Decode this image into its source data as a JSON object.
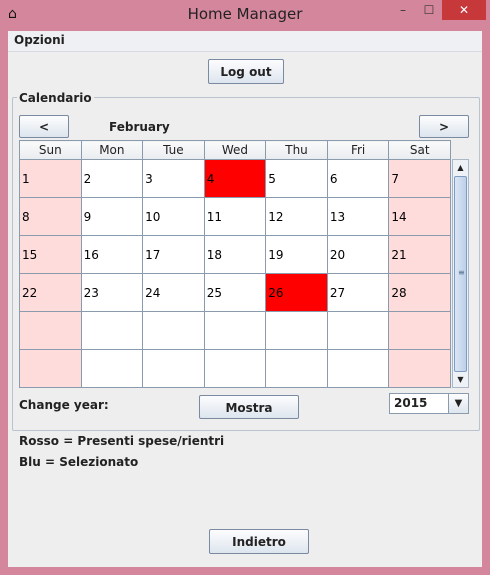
{
  "window": {
    "title": "Home Manager",
    "home_icon": "home-icon",
    "minimize": "–",
    "maximize": "☐",
    "close": "✕"
  },
  "menu": {
    "opzioni": "Opzioni"
  },
  "buttons": {
    "logout": "Log out",
    "prev": "<",
    "next": ">",
    "mostra": "Mostra",
    "indietro": "Indietro"
  },
  "calendar": {
    "group_title": "Calendario",
    "month": "February",
    "headers": [
      "Sun",
      "Mon",
      "Tue",
      "Wed",
      "Thu",
      "Fri",
      "Sat"
    ],
    "rows": [
      [
        "1",
        "2",
        "3",
        "4",
        "5",
        "6",
        "7"
      ],
      [
        "8",
        "9",
        "10",
        "11",
        "12",
        "13",
        "14"
      ],
      [
        "15",
        "16",
        "17",
        "18",
        "19",
        "20",
        "21"
      ],
      [
        "22",
        "23",
        "24",
        "25",
        "26",
        "27",
        "28"
      ],
      [
        "",
        "",
        "",
        "",
        "",
        "",
        ""
      ],
      [
        "",
        "",
        "",
        "",
        "",
        "",
        ""
      ]
    ],
    "highlighted_days": [
      "4",
      "26"
    ],
    "colors": {
      "highlight": "#ff0000",
      "weekend": "#ffdcdc"
    }
  },
  "year": {
    "label": "Change year:",
    "selected": "2015"
  },
  "legend": {
    "rosso": "Rosso = Presenti spese/rientri",
    "blu": "Blu = Selezionato"
  }
}
